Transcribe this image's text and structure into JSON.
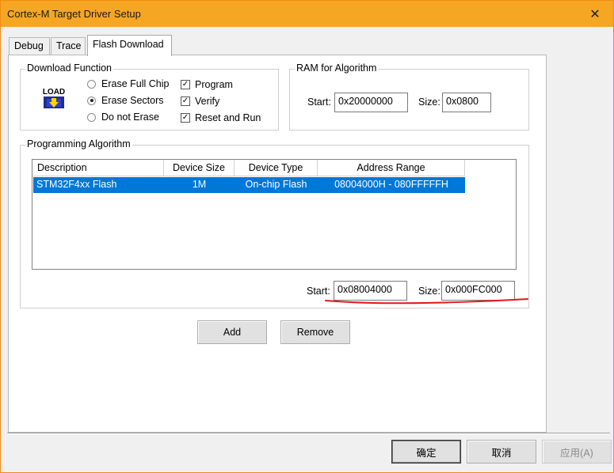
{
  "window": {
    "title": "Cortex-M Target Driver Setup",
    "close_glyph": "✕"
  },
  "tabs": [
    {
      "label": "Debug"
    },
    {
      "label": "Trace"
    },
    {
      "label": "Flash Download",
      "active": true
    }
  ],
  "download_function": {
    "title": "Download Function",
    "icon_label": "LOAD",
    "radios": [
      {
        "label": "Erase Full Chip",
        "checked": false
      },
      {
        "label": "Erase Sectors",
        "checked": true
      },
      {
        "label": "Do not Erase",
        "checked": false
      }
    ],
    "checks": [
      {
        "label": "Program",
        "checked": true
      },
      {
        "label": "Verify",
        "checked": true
      },
      {
        "label": "Reset and Run",
        "checked": true
      }
    ]
  },
  "ram_for_algorithm": {
    "title": "RAM for Algorithm",
    "start_label": "Start:",
    "start_value": "0x20000000",
    "size_label": "Size:",
    "size_value": "0x0800"
  },
  "programming_algorithm": {
    "title": "Programming Algorithm",
    "columns": [
      "Description",
      "Device Size",
      "Device Type",
      "Address Range"
    ],
    "rows": [
      {
        "description": "STM32F4xx Flash",
        "device_size": "1M",
        "device_type": "On-chip Flash",
        "address_range": "08004000H - 080FFFFFH",
        "selected": true
      }
    ],
    "start_label": "Start:",
    "start_value": "0x08004000",
    "size_label": "Size:",
    "size_value": "0x000FC000",
    "annotation_color": "#e8141c"
  },
  "buttons": {
    "add": "Add",
    "remove": "Remove"
  },
  "footer": {
    "ok": "确定",
    "cancel": "取消",
    "apply": "应用(A)"
  },
  "colors": {
    "title_bar": "#f5a623",
    "selection": "#0078d7",
    "window_border": "#f28a14"
  }
}
